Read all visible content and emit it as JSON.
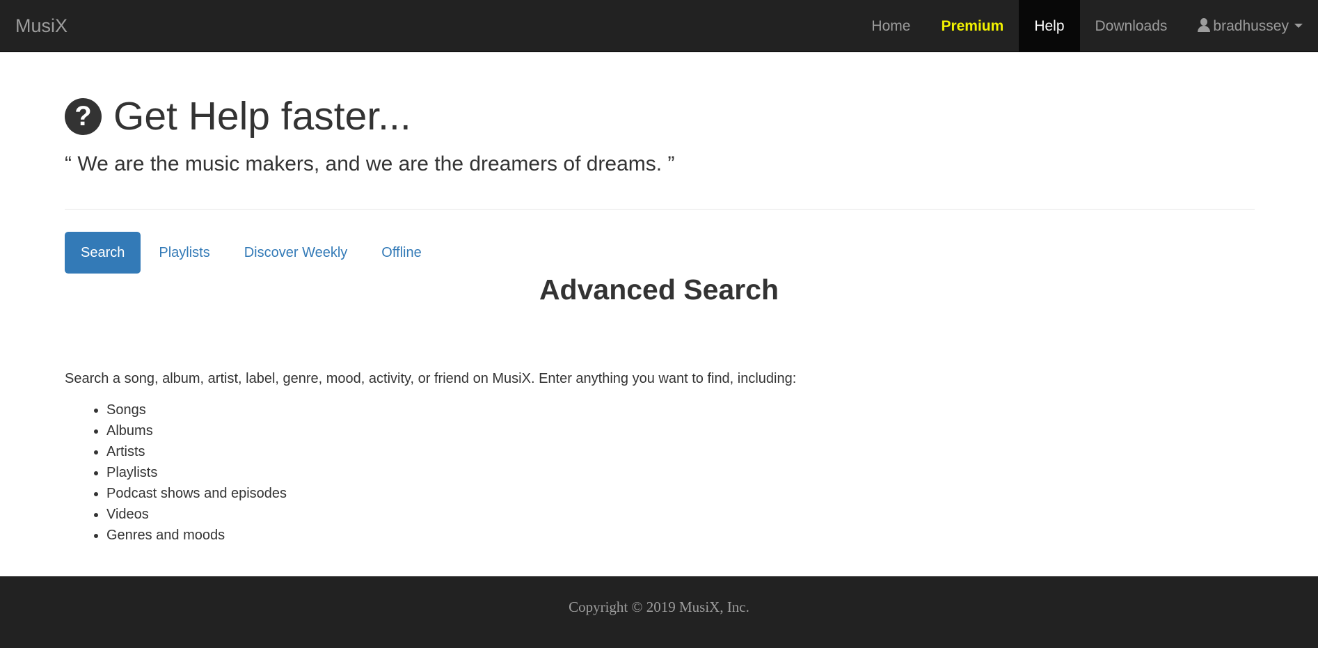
{
  "navbar": {
    "brand": "MusiX",
    "items": [
      {
        "label": "Home"
      },
      {
        "label": "Premium"
      },
      {
        "label": "Help"
      },
      {
        "label": "Downloads"
      }
    ],
    "user": {
      "label": "bradhussey",
      "icon": "user-icon"
    },
    "colors": {
      "background": "#222222",
      "text": "#9d9d9d",
      "premium": "#f2f200",
      "active_background": "#080808"
    }
  },
  "header": {
    "icon": "question-circle-icon",
    "title": "Get Help faster...",
    "quote": "“ We are the music makers, and we are the dreamers of dreams. ”"
  },
  "tabs": [
    {
      "label": "Search",
      "active": true
    },
    {
      "label": "Playlists",
      "active": false
    },
    {
      "label": "Discover Weekly",
      "active": false
    },
    {
      "label": "Offline",
      "active": false
    }
  ],
  "section": {
    "heading": "Advanced Search",
    "intro": "Search a song, album, artist, label, genre, mood, activity, or friend on MusiX. Enter anything you want to find, including:",
    "items": [
      "Songs",
      "Albums",
      "Artists",
      "Playlists",
      "Podcast shows and episodes",
      "Videos",
      "Genres and moods"
    ]
  },
  "footer": {
    "copyright": "Copyright © 2019 MusiX, Inc."
  },
  "accent_color": "#337ab7"
}
